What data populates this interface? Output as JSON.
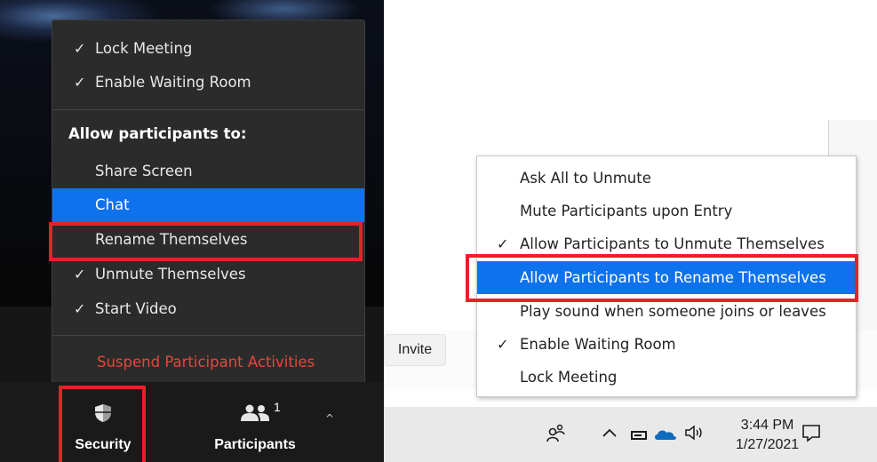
{
  "security_menu": {
    "items_top": [
      {
        "label": "Lock Meeting",
        "checked": true
      },
      {
        "label": "Enable Waiting Room",
        "checked": true
      }
    ],
    "heading": "Allow participants to:",
    "allow_items": [
      {
        "label": "Share Screen",
        "checked": false,
        "highlighted": false
      },
      {
        "label": "Chat",
        "checked": false,
        "highlighted": true
      },
      {
        "label": "Rename Themselves",
        "checked": false,
        "highlighted": false,
        "callout": true
      },
      {
        "label": "Unmute Themselves",
        "checked": true,
        "highlighted": false
      },
      {
        "label": "Start Video",
        "checked": true,
        "highlighted": false
      }
    ],
    "suspend_label": "Suspend Participant Activities",
    "check_glyph": "✓"
  },
  "toolbar": {
    "security_label": "Security",
    "security_icon": "shield-icon",
    "participants_label": "Participants",
    "participants_icon": "people-icon",
    "participants_count": "1",
    "caret": "^"
  },
  "participants_panel": {
    "invite_label": "Invite",
    "menu_items": [
      {
        "label": "Ask All to Unmute",
        "checked": false
      },
      {
        "label": "Mute Participants upon Entry",
        "checked": false
      },
      {
        "label": "Allow Participants to Unmute Themselves",
        "checked": true
      },
      {
        "label": "Allow Participants to Rename Themselves",
        "checked": false,
        "highlighted": true,
        "callout": true
      },
      {
        "label": "Play sound when someone joins or leaves",
        "checked": false
      },
      {
        "label": "Enable Waiting Room",
        "checked": true
      },
      {
        "label": "Lock Meeting",
        "checked": false
      }
    ]
  },
  "taskbar": {
    "time": "3:44 PM",
    "date": "1/27/2021",
    "icons": [
      "people-icon",
      "chevron-up-icon",
      "battery-icon",
      "onedrive-cloud-icon",
      "speaker-icon",
      "notification-icon"
    ]
  },
  "colors": {
    "highlight_blue": "#0e72ed",
    "callout_red": "#e8202a",
    "suspend_red": "#e5473b",
    "dark_menu": "#2b2b2b"
  }
}
